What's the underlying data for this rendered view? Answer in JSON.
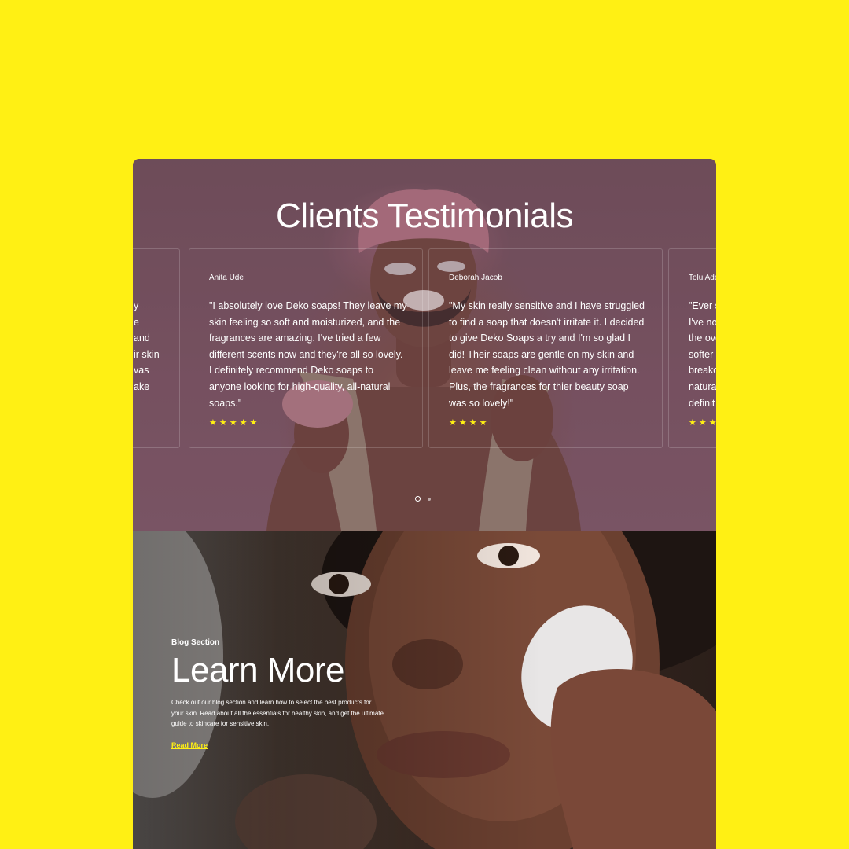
{
  "colors": {
    "background": "#fff014",
    "accent": "#fff014",
    "testimonial_overlay": "#7a5564",
    "text": "#ffffff"
  },
  "testimonials": {
    "title": "Clients Testimonials",
    "cards": [
      {
        "name": "",
        "quote_lines": [
          "",
          "y",
          "e",
          "and",
          "ir skin",
          "vas",
          "",
          "ake"
        ],
        "stars": ""
      },
      {
        "name": "Anita Ude",
        "quote": "\"I absolutely love Deko soaps! They leave my skin feeling so soft and moisturized, and the fragrances are amazing. I've tried a few different scents now and they're all so lovely. I definitely recommend Deko soaps to anyone looking for high-quality, all-natural soaps.\"",
        "stars": "★★★★★",
        "rating": 5
      },
      {
        "name": "Deborah Jacob",
        "quote": "\"My skin really sensitive and I have struggled to find a soap that doesn't irritate it. I decided to give Deko Soaps a try and I'm so glad I did! Their soaps are gentle on my skin and leave me feeling clean without any irritation. Plus, the fragrances for thier beauty soap was so lovely!\"",
        "stars": "★★★★",
        "rating": 4
      },
      {
        "name": "Tolu Ade",
        "quote_lines": [
          "\"Ever s",
          "I've no",
          "the ove",
          "softer",
          "breako",
          "natura",
          "definit"
        ],
        "stars": "★★★"
      }
    ],
    "pagination": {
      "pages": 2,
      "active": 1
    }
  },
  "blog": {
    "kicker": "Blog Section",
    "title": "Learn More",
    "description": "Check out our blog section and learn how to select the best products for your skin. Read about all the essentials for healthy skin, and get the ultimate guide to skincare for sensitive skin.",
    "link": "Read More"
  }
}
